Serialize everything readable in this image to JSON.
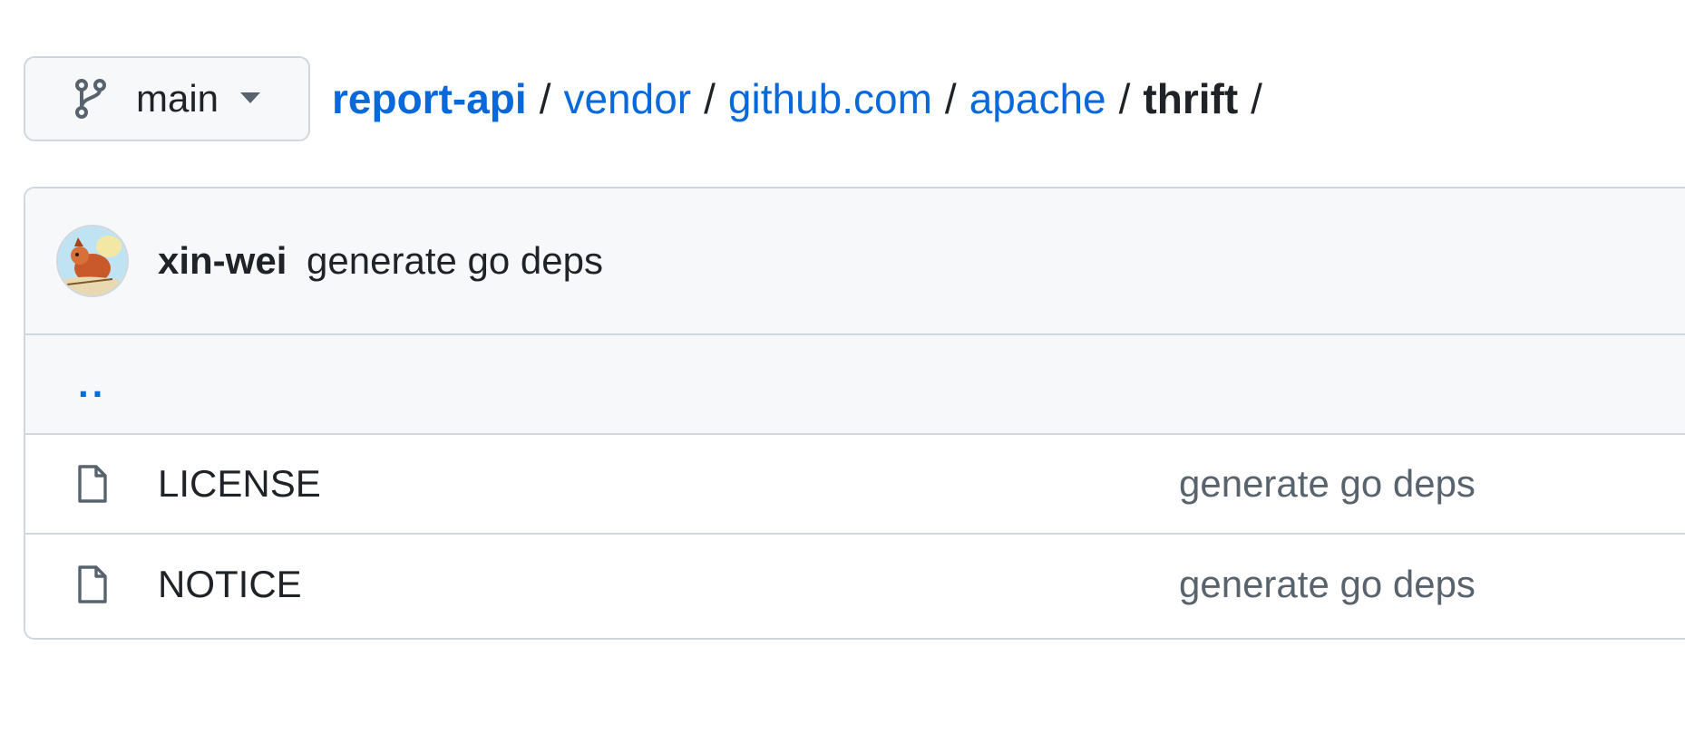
{
  "branch": {
    "name": "main",
    "icon": "git-branch-icon"
  },
  "breadcrumb": {
    "root": "report-api",
    "parts": [
      "vendor",
      "github.com",
      "apache"
    ],
    "current": "thrift",
    "separator": "/"
  },
  "latest_commit": {
    "author": "xin-wei",
    "message": "generate go deps"
  },
  "parent_dir": "..",
  "files": [
    {
      "name": "LICENSE",
      "icon": "file-icon",
      "commit_message": "generate go deps"
    },
    {
      "name": "NOTICE",
      "icon": "file-icon",
      "commit_message": "generate go deps"
    }
  ],
  "colors": {
    "link": "#0969da",
    "text": "#1f2328",
    "muted": "#59636e",
    "border": "#d0d7de",
    "header_bg": "#f6f8fa"
  }
}
